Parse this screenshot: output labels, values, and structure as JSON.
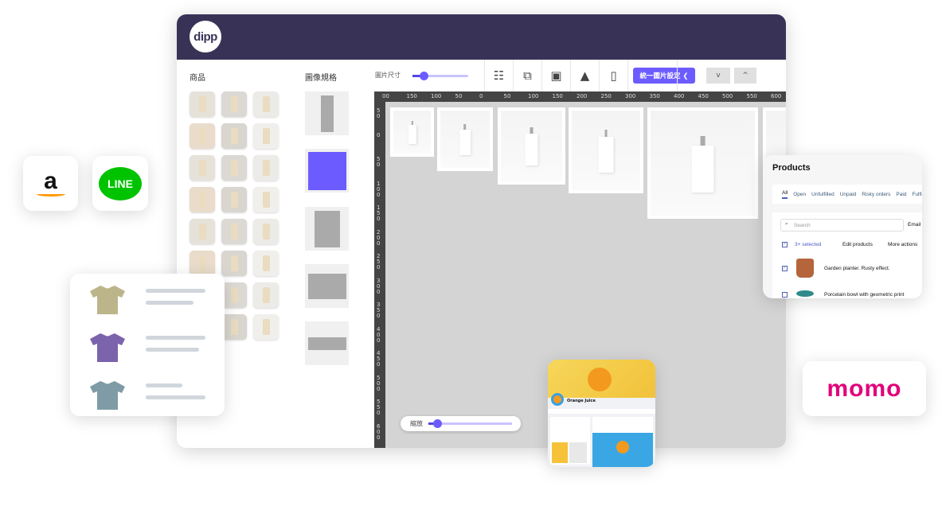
{
  "app": {
    "logo": "dipp"
  },
  "left_panel": {
    "products_label": "商品",
    "spec_label": "圖像規格"
  },
  "toolbar": {
    "image_size_label": "圖片尺寸",
    "image_size_value": 0.2,
    "unify_button": "統一圖片設定 ❮",
    "down": "v",
    "up": "^",
    "icons": [
      "sliders-icon",
      "image-edit-icon",
      "image-frame-icon",
      "shapes-icon",
      "mobile-preview-icon"
    ]
  },
  "canvas": {
    "ruler_top": [
      "00",
      "150",
      "100",
      "50",
      "0",
      "50",
      "100",
      "150",
      "200",
      "250",
      "300",
      "350",
      "400",
      "450",
      "500",
      "550",
      "600"
    ],
    "ruler_left": [
      "50",
      "0",
      "50",
      "100",
      "150",
      "200",
      "250",
      "300",
      "350",
      "400",
      "450",
      "500",
      "550",
      "600",
      "6"
    ],
    "zoom_label": "縮放",
    "zoom_value": 0.1
  },
  "products_card": {
    "title": "Products",
    "tabs": [
      "All",
      "Open",
      "Unfulfilled",
      "Unpaid",
      "Risky orders",
      "Paid",
      "Fulfi"
    ],
    "search_placeholder": "Search",
    "email": "Email",
    "selected": "3+ selected",
    "edit": "Edit products",
    "more": "More actions",
    "rows": [
      "Garden planter. Rusty effect.",
      "Porcelain bowl with geometric print"
    ]
  },
  "facebook_card": {
    "page_name": "Orange Juice"
  },
  "brands": {
    "amazon": "a",
    "line": "LINE",
    "momo": "momo"
  },
  "colors": {
    "header": "#383356",
    "accent": "#6c5cff",
    "line": "#00c300",
    "momo": "#e2007a",
    "shirts": [
      "#bdb58a",
      "#7b64ac",
      "#7f9ca6"
    ]
  }
}
